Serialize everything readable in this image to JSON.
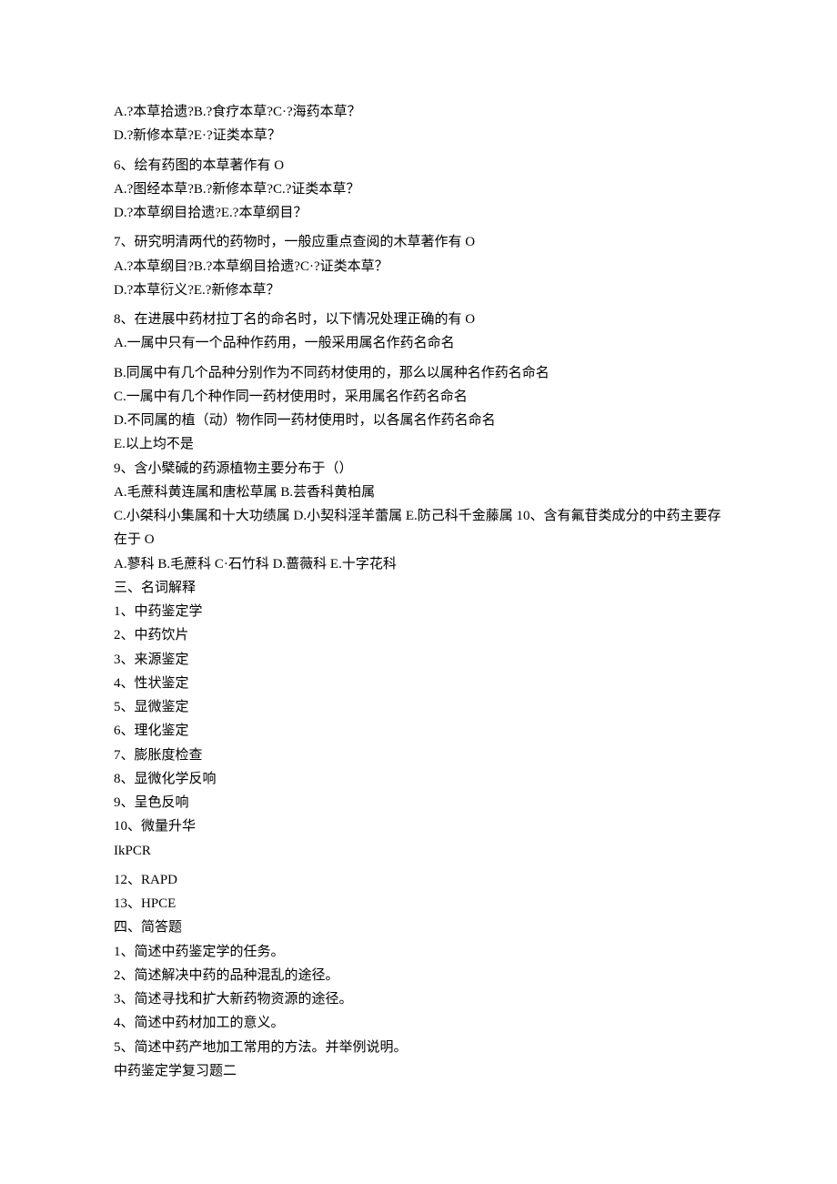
{
  "lines": [
    "A.?本草拾遗?B.?食疗本草?C·?海药本草？",
    "D.?新修本草?E·?证类本草？",
    "__GAP__",
    "6、绘有药图的本草著作有 O",
    "A.?图经本草?B.?新修本草?C.?证类本草？",
    "D.?本草纲目拾遗?E.?本草纲目？",
    "__GAP__",
    "7、研究明清两代的药物时，一般应重点查阅的木草著作有 O",
    "A.?本草纲目?B.?本草纲目拾遗?C·?证类本草？",
    "D.?本草衍义?E.?新修本草？",
    "__GAP__",
    "8、在进展中药材拉丁名的命名时，以下情况处理正确的有 O",
    "A.一属中只有一个品种作药用，一般采用属名作药名命名",
    "__GAP__",
    "B.同属中有几个品种分别作为不同药材使用的，那么以属种名作药名命名",
    "C.一属中有几个种作同一药材使用时，采用属名作药名命名",
    "D.不同属的植（动）物作同一药材使用时，以各属名作药名命名",
    "E.以上均不是",
    "9、含小檗碱的药源植物主要分布于（）",
    "A.毛蔗科黄连属和唐松草属 B.芸香科黄柏属",
    "C.小桀科小集属和十大功绩属 D.小契科淫羊蕾属 E.防己科千金藤属 10、含有氟苷类成分的中药主要存在于 O",
    "A.蓼科 B.毛蔗科 C·石竹科 D.蔷薇科 E.十字花科",
    "三、名词解释",
    "1、中药鉴定学",
    "2、中药饮片",
    "3、来源鉴定",
    "4、性状鉴定",
    "5、显微鉴定",
    "6、理化鉴定",
    "7、膨胀度检查",
    "8、显微化学反响",
    "9、呈色反响",
    "10、微量升华",
    "IkPCR",
    "__GAP__",
    "12、RAPD",
    "13、HPCE",
    "四、简答题",
    "1、简述中药鉴定学的任务。",
    "2、简述解决中药的品种混乱的途径。",
    "3、简述寻找和扩大新药物资源的途径。",
    "4、简述中药材加工的意义。",
    "5、简述中药产地加工常用的方法。并举例说明。",
    "中药鉴定学复习题二"
  ]
}
